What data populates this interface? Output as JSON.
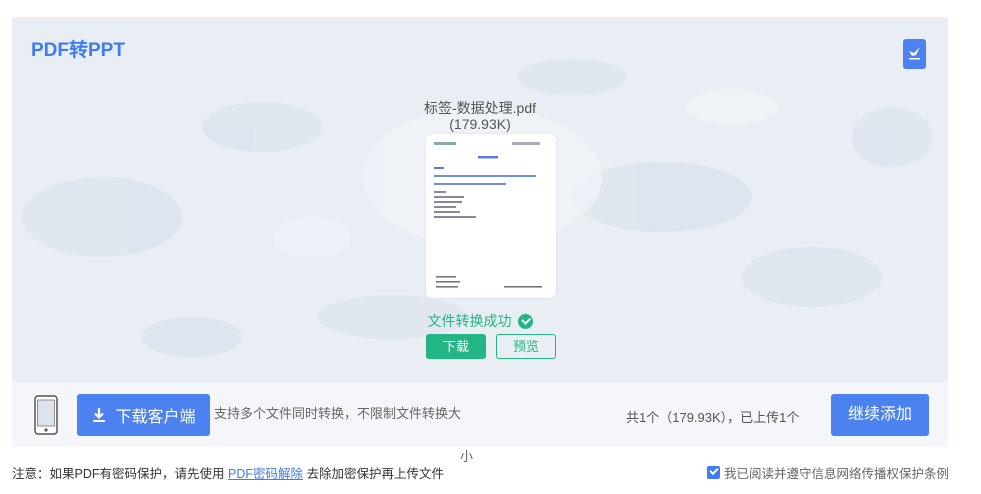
{
  "app": {
    "title": "PDF转PPT",
    "corner_icon": "bird-logo-icon"
  },
  "file": {
    "name": "标签-数据处理.pdf",
    "size": "(179.93K)",
    "status": "文件转换成功",
    "download_label": "下载",
    "preview_label": "预览"
  },
  "bar": {
    "client_button": "下载客户端",
    "support_text": "支持多个文件同时转换，不限制文件转换大",
    "support_tail": "小",
    "count_text": "共1个（179.93K），已上传1个",
    "continue_button": "继续添加"
  },
  "footer": {
    "note_prefix": "注意：如果PDF有密码保护，请先使用 ",
    "note_link": "PDF密码解除",
    "note_suffix": " 去除加密保护再上传文件",
    "agree_text": "我已阅读并遵守信息网络传播权保护条例"
  },
  "colors": {
    "accent": "#3d7cf2",
    "success": "#23b583",
    "button": "#4b82f0"
  }
}
